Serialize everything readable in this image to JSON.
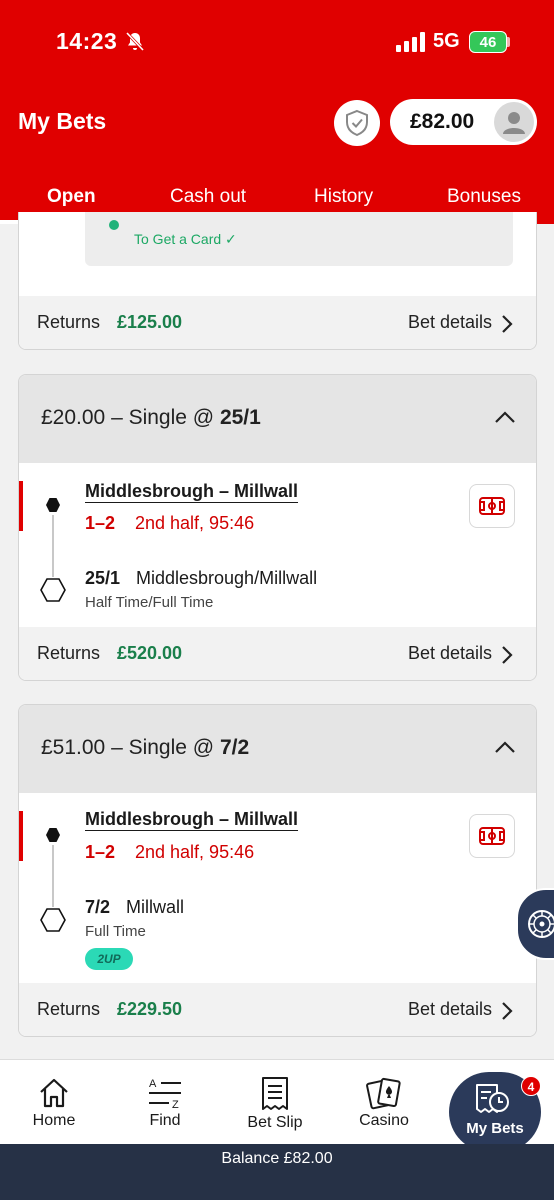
{
  "status_bar": {
    "time": "14:23",
    "network": "5G",
    "battery": "46"
  },
  "header": {
    "title": "My Bets",
    "balance": "£82.00"
  },
  "tabs": [
    {
      "label": "Open",
      "active": true
    },
    {
      "label": "Cash out",
      "active": false
    },
    {
      "label": "History",
      "active": false
    },
    {
      "label": "Bonuses",
      "active": false
    }
  ],
  "previous_bet": {
    "promo_text": "To Get a Card ✓",
    "returns_label": "Returns",
    "returns_value": "£125.00",
    "details_label": "Bet details"
  },
  "bets": [
    {
      "stake_type": "£20.00 – Single @ ",
      "odds": "25/1",
      "match": "Middlesbrough – Millwall",
      "score": "1–2",
      "state": "2nd half, 95:46",
      "selection_odds": "25/1",
      "selection": "Middlesbrough/Millwall",
      "market": "Half Time/Full Time",
      "badge": "",
      "returns_label": "Returns",
      "returns_value": "£520.00",
      "details_label": "Bet details"
    },
    {
      "stake_type": "£51.00 – Single @ ",
      "odds": "7/2",
      "match": "Middlesbrough – Millwall",
      "score": "1–2",
      "state": "2nd half, 95:46",
      "selection_odds": "7/2",
      "selection": "Millwall",
      "market": "Full Time",
      "badge": "2UP",
      "returns_label": "Returns",
      "returns_value": "£229.50",
      "details_label": "Bet details"
    }
  ],
  "bottom_nav": {
    "items": [
      {
        "label": "Home",
        "icon": "home-icon"
      },
      {
        "label": "Find",
        "icon": "find-icon"
      },
      {
        "label": "Bet Slip",
        "icon": "bet-slip-icon"
      },
      {
        "label": "Casino",
        "icon": "casino-icon"
      },
      {
        "label": "My Bets",
        "icon": "my-bets-icon",
        "badge": "4",
        "active": true
      }
    ]
  },
  "balance_bar": "Balance £82.00",
  "colors": {
    "brand_red": "#e00000",
    "navy": "#2b3a5a",
    "returns_green": "#1a7f4b",
    "badge_teal": "#2bd9b6"
  }
}
